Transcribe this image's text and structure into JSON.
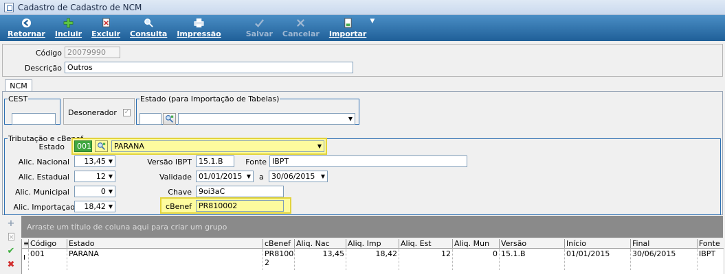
{
  "window": {
    "title": "Cadastro de Cadastro de NCM"
  },
  "toolbar": {
    "retornar": "Retornar",
    "incluir": "Incluir",
    "excluir": "Excluir",
    "consulta": "Consulta",
    "impressao": "Impressão",
    "salvar": "Salvar",
    "cancelar": "Cancelar",
    "importar": "Importar"
  },
  "header": {
    "codigo_label": "Código",
    "codigo_value": "20079990",
    "descricao_label": "Descrição",
    "descricao_value": "Outros"
  },
  "tabs": [
    "NCM"
  ],
  "cest": {
    "legend": "CEST",
    "value": ""
  },
  "desonerador": {
    "label": "Desonerador",
    "checked": true
  },
  "estado_import": {
    "legend": "Estado (para Importação de Tabelas)",
    "code": "",
    "name": ""
  },
  "tributacao": {
    "legend": "Tributação e cBenef",
    "estado_label": "Estado",
    "estado_code": "001",
    "estado_name": "PARANA",
    "alic_nacional_label": "Alic. Nacional",
    "alic_nacional": "13,45",
    "alic_estadual_label": "Alic. Estadual",
    "alic_estadual": "12",
    "alic_municipal_label": "Alic. Municipal",
    "alic_municipal": "0",
    "alic_importacao_label": "Alic. Importaçao",
    "alic_importacao": "18,42",
    "versao_label": "Versão IBPT",
    "versao": "15.1.B",
    "fonte_label": "Fonte",
    "fonte": "IBPT",
    "validade_label": "Validade",
    "validade_de": "01/01/2015",
    "validade_a_label": "a",
    "validade_ate": "30/06/2015",
    "chave_label": "Chave",
    "chave": "9oi3aC",
    "cbenef_label": "cBenef",
    "cbenef": "PR810002"
  },
  "grid": {
    "group_hint": "Arraste um título de coluna aqui para criar um grupo",
    "columns": [
      "Código",
      "Estado",
      "cBenef",
      "Aliq. Nac",
      "Aliq. Imp",
      "Aliq. Est",
      "Aliq. Mun",
      "Versão",
      "Início",
      "Final",
      "Fonte"
    ],
    "rows": [
      {
        "marker": "I",
        "codigo": "001",
        "estado": "PARANA",
        "cbenef_1": "PR81000",
        "cbenef_2": "2",
        "aliq_nac": "13,45",
        "aliq_imp": "18,42",
        "aliq_est": "12",
        "aliq_mun": "0",
        "versao": "15.1.B",
        "inicio": "01/01/2015",
        "final": "30/06/2015",
        "fonte": "IBPT"
      }
    ]
  },
  "colors": {
    "toolbar": "#1f5f98",
    "highlight": "#fdfb9e",
    "fieldset_border": "#2d6fb2",
    "group_panel": "#8a8a8a"
  }
}
